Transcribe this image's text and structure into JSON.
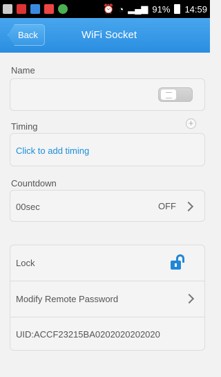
{
  "status_bar": {
    "time": "14:59",
    "battery": "91%",
    "signal": "ᵍ"
  },
  "nav": {
    "back_label": "Back",
    "title": "WiFi Socket"
  },
  "name_section": {
    "label": "Name",
    "switch_on": false
  },
  "timing_section": {
    "label": "Timing",
    "add_text": "Click to add timing"
  },
  "countdown_section": {
    "label": "Countdown",
    "value": "00sec",
    "state": "OFF"
  },
  "settings": {
    "lock_label": "Lock",
    "modify_password_label": "Modify Remote Password",
    "uid": "UID:ACCF23215BA0202020202020"
  },
  "colors": {
    "nav_bar": "#2a8ee0",
    "link_text": "#1a8fd9",
    "lock_icon": "#2187d6"
  }
}
